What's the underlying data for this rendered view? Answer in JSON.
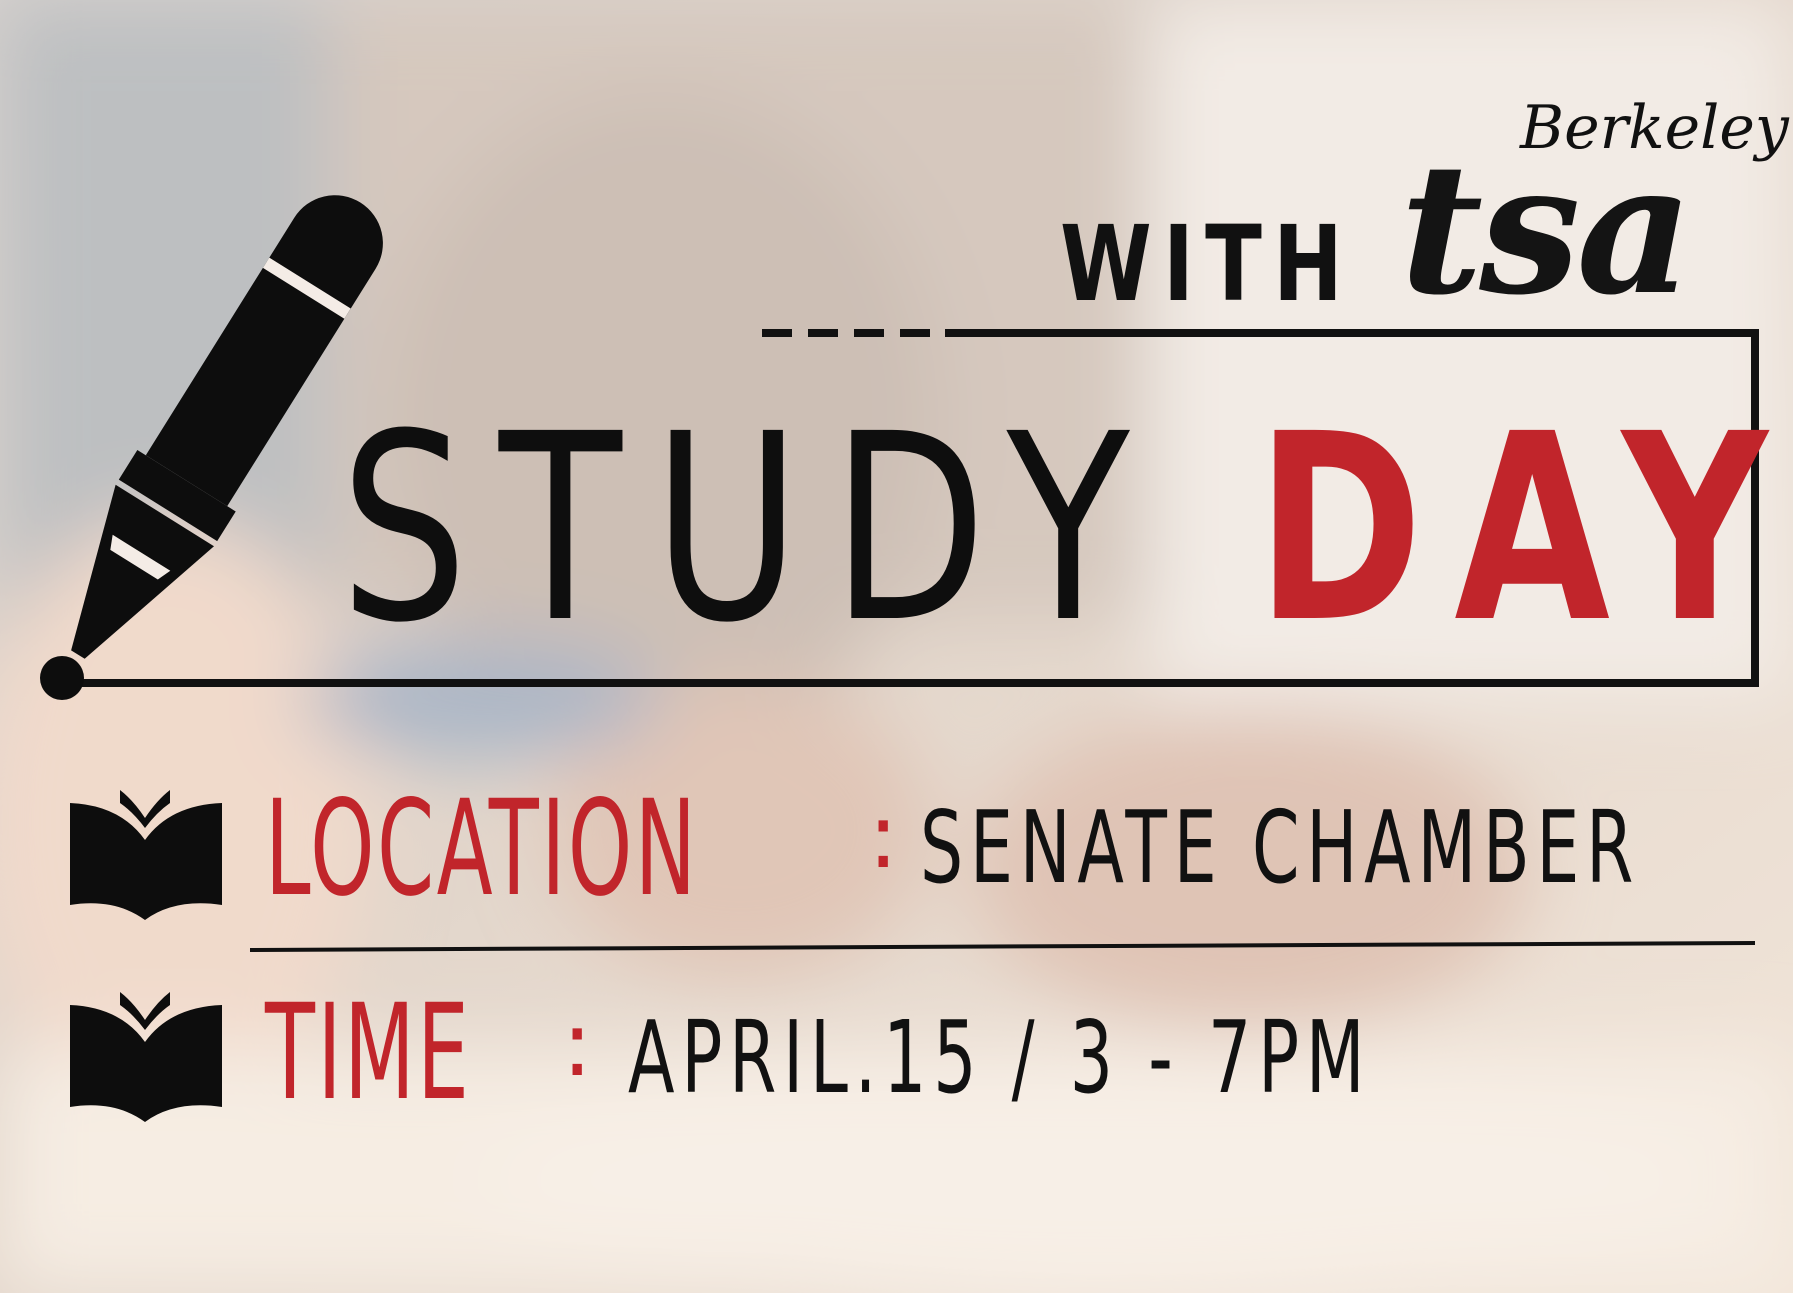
{
  "header": {
    "with_text": "WITH",
    "brand_top": "Berkeley",
    "brand_main": "tsa"
  },
  "title": {
    "word1": "STUDY",
    "word2": "DAY"
  },
  "details": {
    "location_label": "LOCATION",
    "location_value": "SENATE CHAMBER",
    "time_label": "TIME",
    "time_value": "APRIL.15 / 3 - 7PM",
    "separator": ":"
  },
  "colors": {
    "accent_red": "#c1252b",
    "ink_black": "#111111"
  },
  "icons": [
    "pencil-icon",
    "open-book-icon"
  ]
}
